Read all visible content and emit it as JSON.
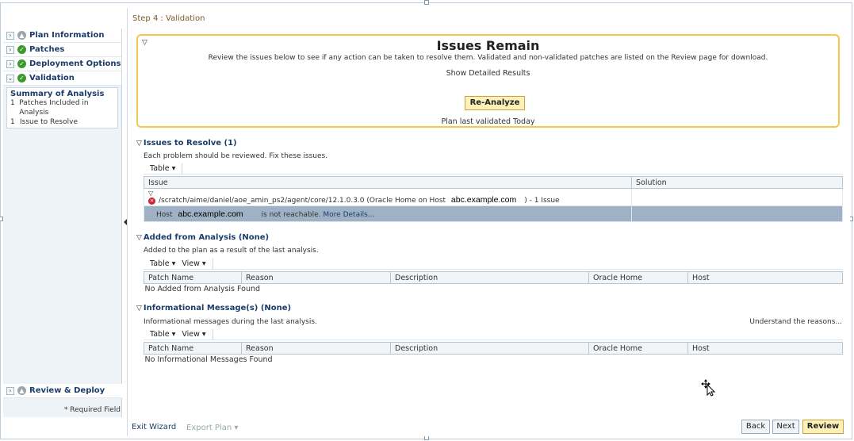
{
  "step": "Step 4 : Validation",
  "nav": {
    "items": [
      {
        "label": "Plan Information",
        "expander": "›",
        "status": "pending"
      },
      {
        "label": "Patches",
        "expander": "›",
        "status": "ok"
      },
      {
        "label": "Deployment Options",
        "expander": "›",
        "status": "ok"
      },
      {
        "label": "Validation",
        "expander": "⌄",
        "status": "ok"
      }
    ],
    "summary": {
      "heading": "Summary of Analysis",
      "rows": [
        {
          "count": "1",
          "label": "Patches Included in Analysis"
        },
        {
          "count": "1",
          "label": "Issue to Resolve"
        }
      ]
    },
    "review_deploy": "Review & Deploy",
    "required": "* Required Field"
  },
  "issues_box": {
    "title": "Issues Remain",
    "desc": "Review the issues below to see if any action can be taken to resolve them. Validated and non-validated patches are listed on the Review page for download.",
    "details_link": "Show Detailed Results",
    "reanalyze": "Re-Analyze",
    "validated": "Plan last validated Today"
  },
  "resolve": {
    "title": "Issues to Resolve (1)",
    "sub": "Each problem should be reviewed. Fix these issues.",
    "toolbar": {
      "table": "Table ▾"
    },
    "columns": [
      "Issue",
      "Solution"
    ],
    "row": {
      "path": "/scratch/aime/daniel/aoe_amin_ps2/agent/core/12.1.0.3.0 (Oracle Home on Host",
      "host": "abc.example.com",
      "suffix": ") - 1 Issue"
    },
    "detail": {
      "prefix": "Host",
      "host": "abc.example.com",
      "msg": "is not reachable.",
      "more": "More Details..."
    }
  },
  "added": {
    "title": "Added from Analysis (None)",
    "sub": "Added to the plan as a result of the last analysis.",
    "toolbar": {
      "table": "Table ▾",
      "view": "View ▾"
    },
    "columns": [
      "Patch Name",
      "Reason",
      "Description",
      "Oracle Home",
      "Host"
    ],
    "empty": "No Added from Analysis Found"
  },
  "info": {
    "title": "Informational Message(s) (None)",
    "sub": "Informational messages during the last analysis.",
    "understand": "Understand the reasons...",
    "toolbar": {
      "table": "Table ▾",
      "view": "View ▾"
    },
    "columns": [
      "Patch Name",
      "Reason",
      "Description",
      "Oracle Home",
      "Host"
    ],
    "empty": "No Informational Messages Found"
  },
  "footer": {
    "exit": "Exit Wizard",
    "export": "Export Plan ▾",
    "back": "Back",
    "next": "Next",
    "review": "Review"
  }
}
